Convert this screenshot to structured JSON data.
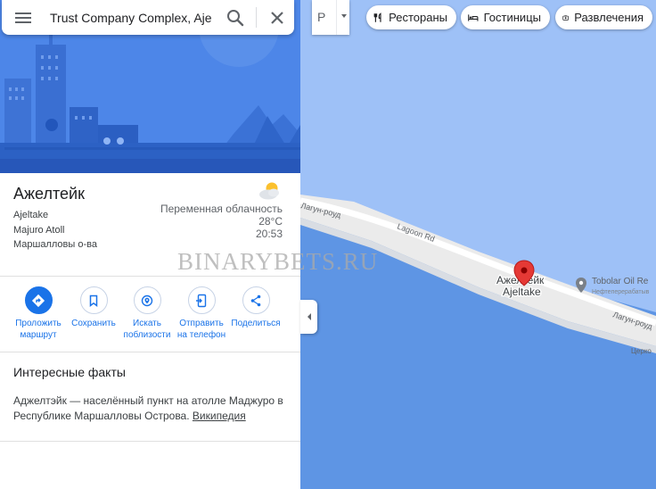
{
  "search": {
    "value": "Trust Company Complex, Ajeltake",
    "menu_icon": "hamburger-menu-icon",
    "search_icon": "magnifier-icon",
    "close_icon": "close-x-icon"
  },
  "place": {
    "title": "Ажелтейк",
    "latin_name": "Ajeltake",
    "atoll": "Majuro Atoll",
    "country": "Маршалловы о-ва"
  },
  "weather": {
    "condition": "Переменная облачность",
    "temperature": "28°C",
    "time": "20:53",
    "icon": "partly-cloudy-icon"
  },
  "actions": [
    {
      "id": "route",
      "label": "Проложить маршрут",
      "icon": "directions-icon"
    },
    {
      "id": "save",
      "label": "Сохранить",
      "icon": "bookmark-icon"
    },
    {
      "id": "nearby",
      "label": "Искать поблизости",
      "icon": "nearby-icon"
    },
    {
      "id": "send",
      "label": "Отправить на телефон",
      "icon": "send-to-phone-icon"
    },
    {
      "id": "share",
      "label": "Поделиться",
      "icon": "share-icon"
    }
  ],
  "facts": {
    "title": "Интересные факты",
    "text": "Аджелтэйк — населённый пункт на атолле Маджуро в Республике Маршалловы Острова.",
    "link_label": "Википедия"
  },
  "map": {
    "layers_label": "Р",
    "chips": [
      {
        "id": "restaurants",
        "label": "Рестораны",
        "icon": "fork-knife-icon"
      },
      {
        "id": "hotels",
        "label": "Гостиницы",
        "icon": "bed-icon"
      },
      {
        "id": "entertainment",
        "label": "Развлечения",
        "icon": "camera-ticket-icon"
      }
    ],
    "road_labels": [
      "Лагун-роуд",
      "Lagoon Rd",
      "Лагун-роуд"
    ],
    "place_label_ru": "Ажелтейк",
    "place_label_en": "Ajeltake",
    "poi_name": "Tobolar Oil Re",
    "poi_subtitle": "Нефтеперерабатыв",
    "church_label": "Церко",
    "colors": {
      "lagoon": "#9ec1f7",
      "ocean": "#5e95e4",
      "land": "#ebebeb",
      "marker": "#e53935",
      "accent": "#1a73e8",
      "hero_background": "#4d86e8"
    }
  },
  "watermark": "BINARYBETS.RU"
}
